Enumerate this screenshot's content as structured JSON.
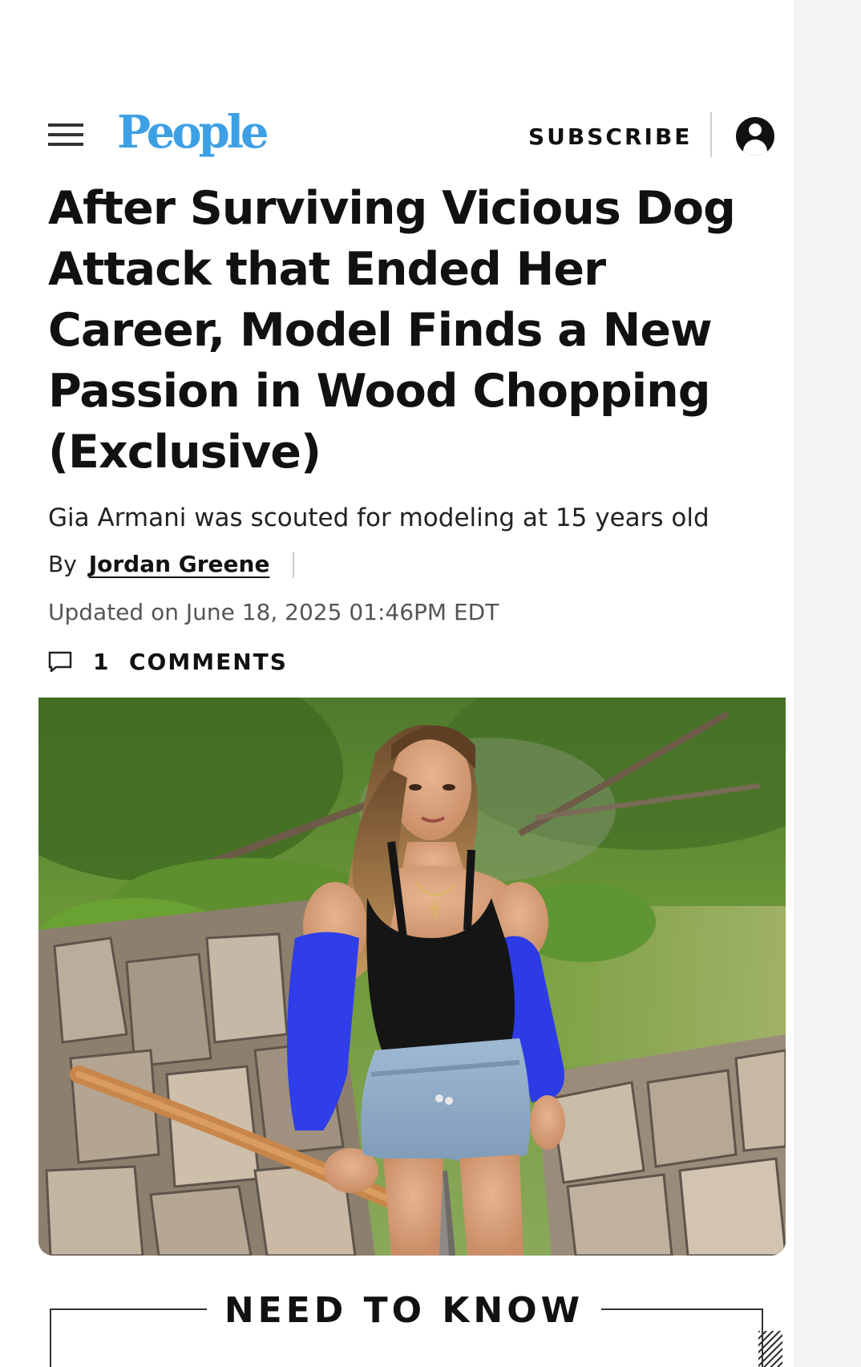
{
  "header": {
    "logo": "People",
    "subscribe_label": "SUBSCRIBE",
    "menu_icon": "hamburger-menu-icon",
    "account_icon": "account-icon"
  },
  "article": {
    "headline_lines": [
      "After Surviving Vicious Dog",
      "Attack that Ended Her",
      "Career, Model Finds a New",
      "Passion in Wood Chopping",
      "(Exclusive)"
    ],
    "subheadline": "Gia Armani was scouted for modeling at 15 years old",
    "byline_prefix": "By",
    "author": "Jordan Greene",
    "updated": "Updated on June 18, 2025 01:46PM EDT",
    "comments_count": "1",
    "comments_label": "COMMENTS"
  },
  "section": {
    "need_to_know_title": "NEED TO KNOW"
  },
  "colors": {
    "logo_blue": "#3ea0e4",
    "text": "#111111",
    "muted": "#555555"
  }
}
